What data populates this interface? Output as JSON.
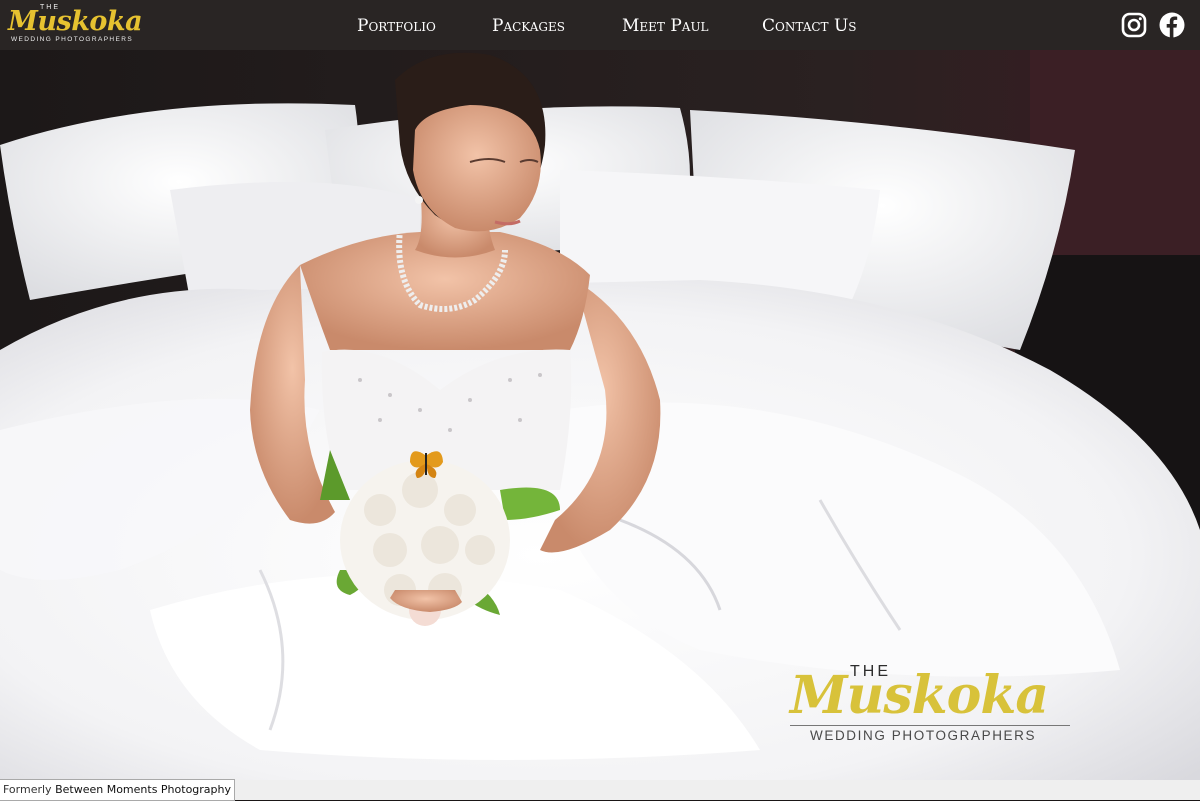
{
  "header": {
    "logo": {
      "the": "THE",
      "script": "Muskoka",
      "sub": "WEDDING PHOTOGRAPHERS"
    },
    "nav": [
      {
        "label": "Portfolio"
      },
      {
        "label": "Packages"
      },
      {
        "label": "Meet Paul"
      },
      {
        "label": "Contact Us"
      }
    ],
    "social": [
      {
        "icon": "instagram-icon"
      },
      {
        "icon": "facebook-icon"
      }
    ]
  },
  "hero": {
    "overlay_logo": {
      "the": "THE",
      "script": "Muskoka",
      "sub": "WEDDING PHOTOGRAPHERS"
    }
  },
  "footer": {
    "prefix": "Formerly",
    "brand": "Between Moments Photography"
  },
  "colors": {
    "header_bg": "#292524",
    "logo_gold": "#e6c230",
    "nav_text": "#ffffff",
    "footer_bg": "#efefef"
  }
}
